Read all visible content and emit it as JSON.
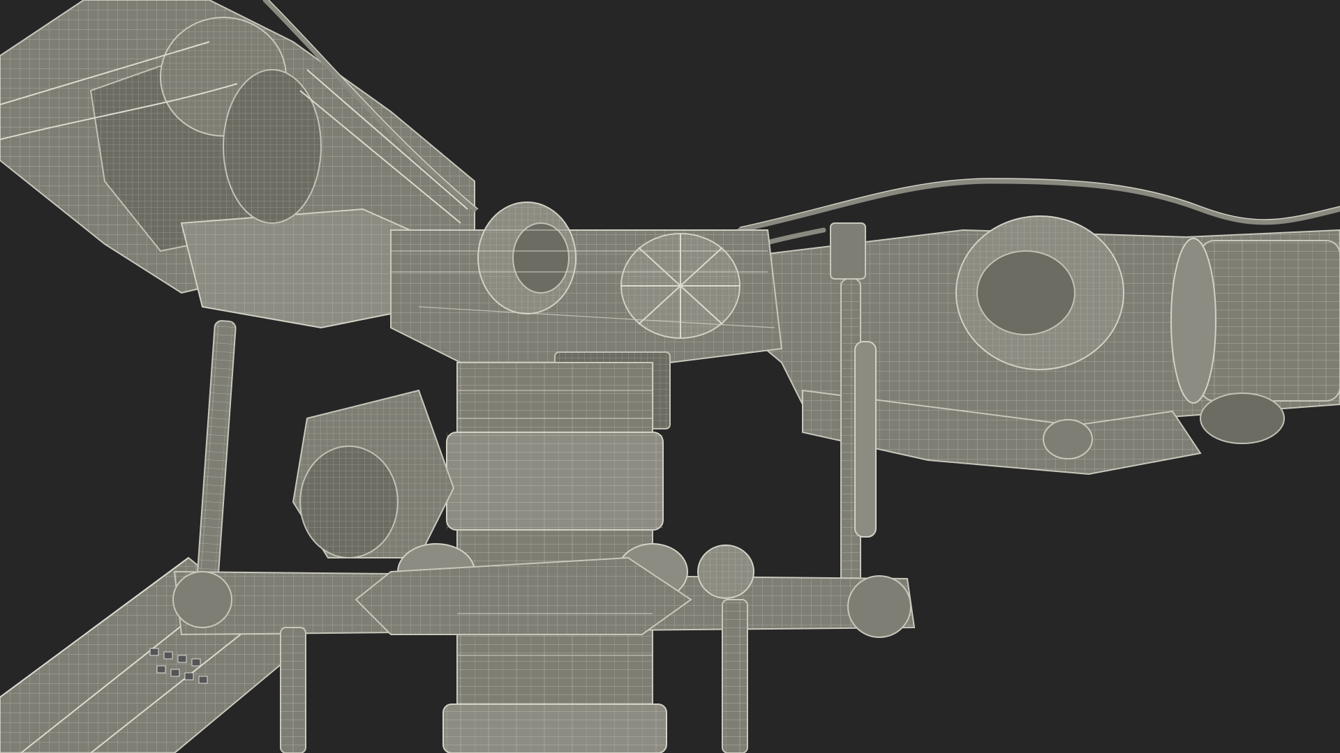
{
  "scene": {
    "background_color": "#262626",
    "model_base_color": "#7f7e74",
    "wireframe_color": "#d6d5ca",
    "parts": [
      "main-rotor-mast",
      "rotor-hub",
      "upper-left-blade-grip",
      "right-blade-grip",
      "lower-left-blade",
      "swashplate",
      "pitch-links",
      "hub-dampers",
      "control-box",
      "hydraulic-lines"
    ]
  }
}
